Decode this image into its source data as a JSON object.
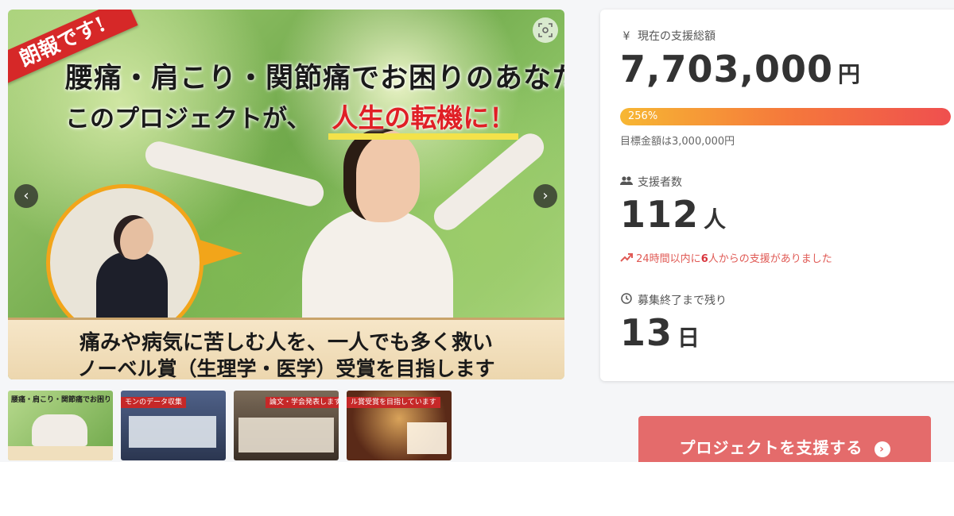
{
  "hero": {
    "ribbon": "朗報です!",
    "headline1": "腰痛・肩こり・関節痛でお困りのあなた",
    "headline2_prefix": "このプロジェクトが、",
    "headline2_accent": "人生の転機に！",
    "banner_line1": "痛みや病気に苦しむ人を、一人でも多く救い",
    "banner_line2": "ノーベル賞（生理学・医学）受賞を目指します",
    "prev_icon": "‹",
    "next_icon": "›"
  },
  "thumbnails": [
    {
      "caption": "腰痛・肩こり・関節痛でお困りのあなた",
      "bg": "#8fbf6a"
    },
    {
      "caption": "モンのデータ収集",
      "bg": "#3b4a6b"
    },
    {
      "caption": "論文・学会発表します",
      "bg": "#5a4a3a"
    },
    {
      "caption": "ル賞受賞を目指しています",
      "bg": "#6b3a2a"
    }
  ],
  "stats": {
    "total_label": "現在の支援総額",
    "total_value": "7,703,000",
    "total_unit": "円",
    "progress_text": "256%",
    "progress_fraction": 1.0,
    "goal_text": "目標金額は3,000,000円",
    "backers_label": "支援者数",
    "backers_value": "112",
    "backers_unit": "人",
    "trend_prefix": "24時間以内に",
    "trend_count": "6",
    "trend_suffix": "人からの支援がありました",
    "remaining_label": "募集終了まで残り",
    "remaining_value": "13",
    "remaining_unit": "日"
  },
  "support_button": {
    "label": "プロジェクトを支援する",
    "chevron": "›"
  },
  "colors": {
    "accent_red": "#e01f26",
    "button": "#e46b6b",
    "progress_start": "#f7b733",
    "progress_end": "#ef4f4f"
  }
}
